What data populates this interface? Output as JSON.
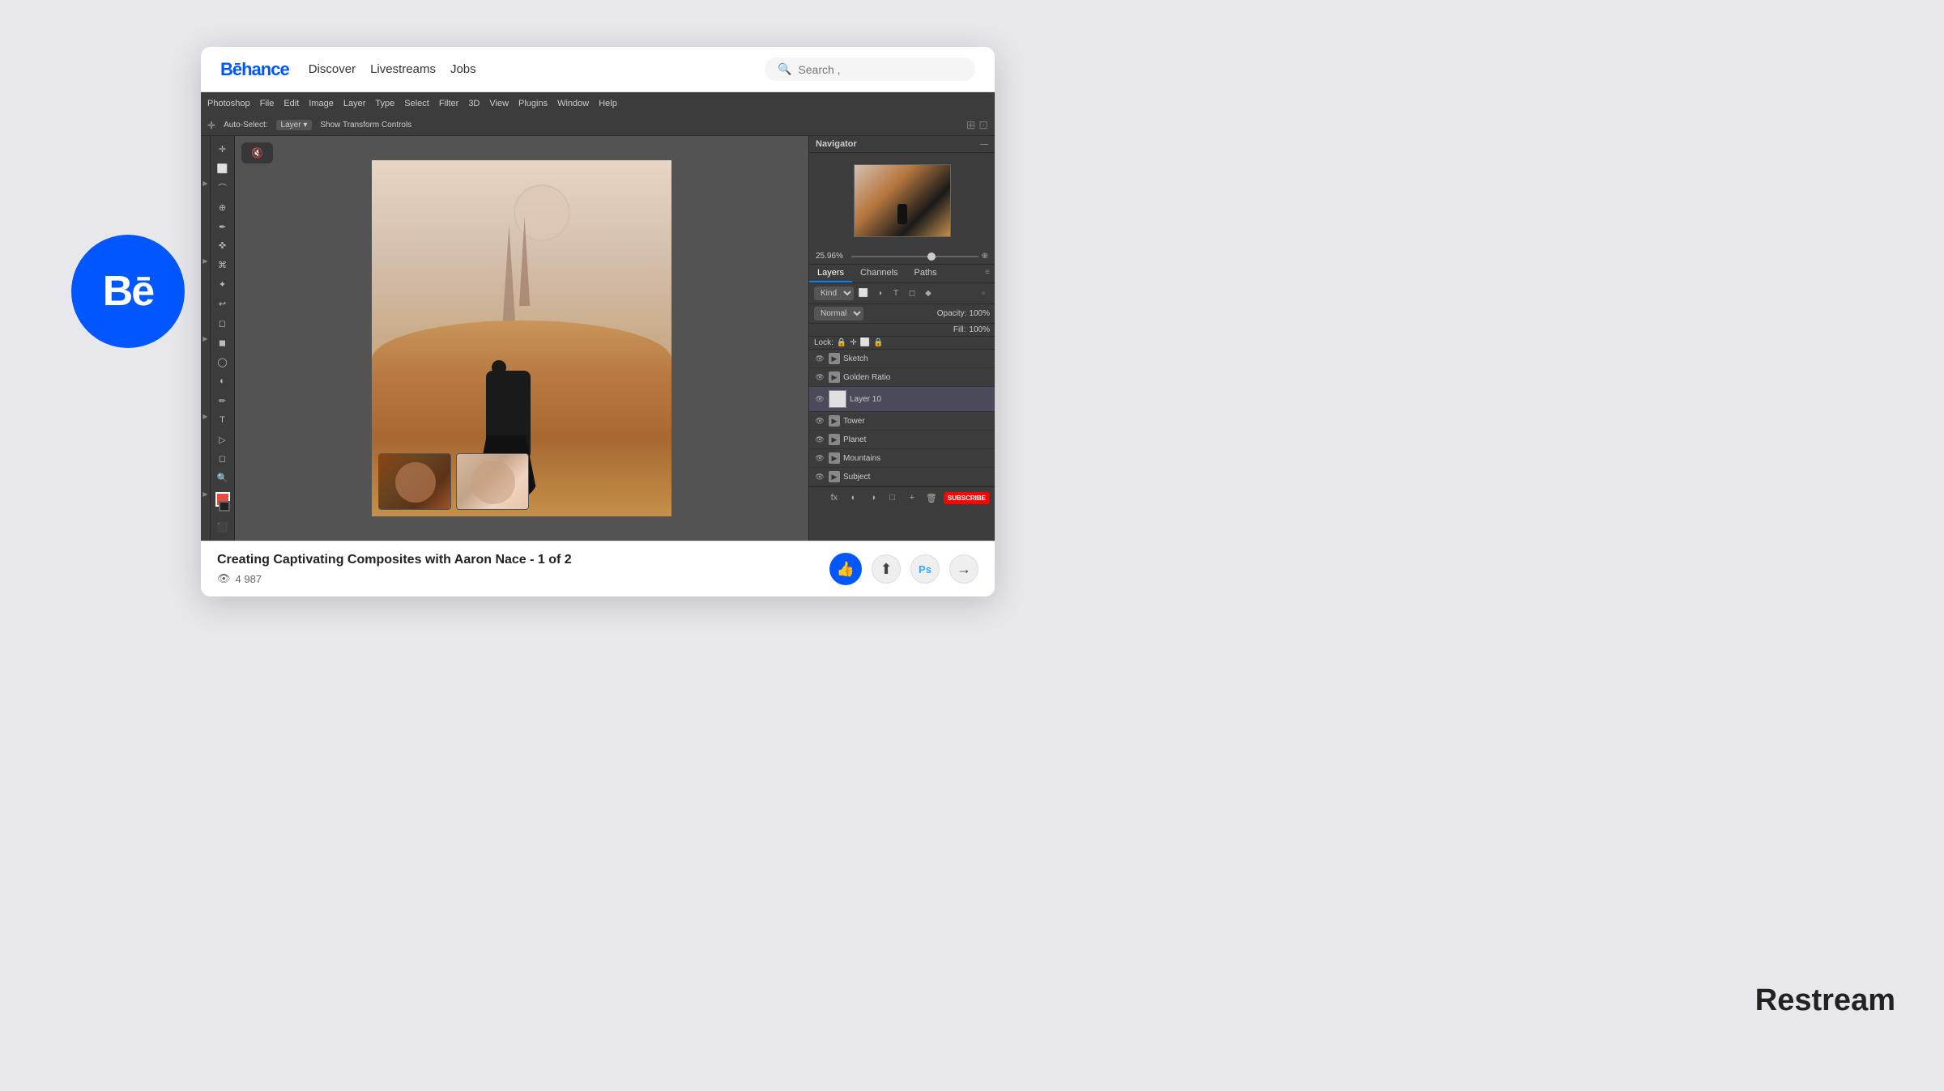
{
  "brand": {
    "name": "Bēhance",
    "logo_text": "Bē"
  },
  "nav": {
    "discover": "Discover",
    "livestreams": "Livestreams",
    "jobs": "Jobs",
    "search_placeholder": "Search ,"
  },
  "photoshop": {
    "menu_items": [
      "Photoshop",
      "File",
      "Edit",
      "Image",
      "Layer",
      "Type",
      "Select",
      "Filter",
      "3D",
      "View",
      "Plugins",
      "Window",
      "Help"
    ],
    "toolbar_label": "Auto-Select:",
    "toolbar_layer": "Layer",
    "toolbar_transform": "Show Transform Controls",
    "zoom_value": "25.96%",
    "panels": {
      "navigator": "Navigator",
      "layers": "Layers",
      "channels": "Channels",
      "paths": "Paths"
    },
    "blend_mode": "Normal",
    "opacity_label": "Opacity:",
    "opacity_value": "100%",
    "fill_label": "Fill:",
    "fill_value": "100%",
    "lock_label": "Lock:",
    "kind_label": "Kind",
    "layers": [
      {
        "name": "Sketch",
        "type": "folder",
        "visible": true
      },
      {
        "name": "Golden Ratio",
        "type": "folder",
        "visible": true
      },
      {
        "name": "Layer 10",
        "type": "layer",
        "visible": true,
        "selected": true
      },
      {
        "name": "Tower",
        "type": "folder",
        "visible": true
      },
      {
        "name": "Planet",
        "type": "folder",
        "visible": true
      },
      {
        "name": "Mountains",
        "type": "folder",
        "visible": true
      },
      {
        "name": "Subject",
        "type": "folder",
        "visible": true
      }
    ]
  },
  "video": {
    "title": "Creating Captivating Composites with Aaron Nace - 1 of 2",
    "views": "4 987",
    "views_icon": "eye"
  },
  "actions": {
    "like": "👍",
    "share": "⬆",
    "photoshop": "Ps",
    "next": "→"
  },
  "restream": "Restream"
}
